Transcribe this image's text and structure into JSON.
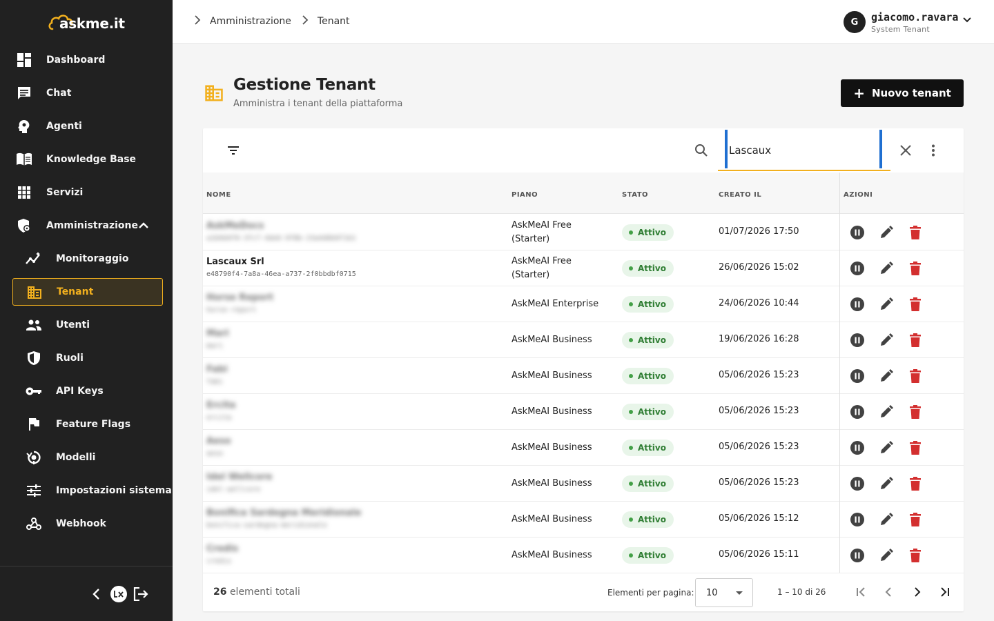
{
  "brand": {
    "logo_text": "askme.it",
    "accent": "#f2b01e"
  },
  "sidebar": {
    "items": [
      {
        "label": "Dashboard",
        "icon": "dashboard-icon"
      },
      {
        "label": "Chat",
        "icon": "chat-icon"
      },
      {
        "label": "Agenti",
        "icon": "agent-icon"
      },
      {
        "label": "Knowledge Base",
        "icon": "book-icon"
      },
      {
        "label": "Servizi",
        "icon": "grid-icon"
      },
      {
        "label": "Amministrazione",
        "icon": "admin-icon",
        "expanded": true
      }
    ],
    "subitems": [
      {
        "label": "Monitoraggio",
        "icon": "monitoring-icon"
      },
      {
        "label": "Tenant",
        "icon": "building-icon",
        "active": true
      },
      {
        "label": "Utenti",
        "icon": "users-icon"
      },
      {
        "label": "Ruoli",
        "icon": "shield-icon"
      },
      {
        "label": "API Keys",
        "icon": "key-icon"
      },
      {
        "label": "Feature Flags",
        "icon": "flag-icon"
      },
      {
        "label": "Modelli",
        "icon": "model-icon"
      },
      {
        "label": "Impostazioni sistema",
        "icon": "settings-sliders-icon"
      },
      {
        "label": "Webhook",
        "icon": "webhook-icon"
      }
    ]
  },
  "header": {
    "breadcrumb": [
      "Amministrazione",
      "Tenant"
    ],
    "user": {
      "initial": "G",
      "name": "giacomo.ravara",
      "role": "System Tenant"
    }
  },
  "page": {
    "title": "Gestione Tenant",
    "subtitle": "Amministra i tenant della piattaforma",
    "new_button": "Nuovo tenant"
  },
  "search": {
    "value": "Lascaux"
  },
  "table": {
    "columns": [
      "NOME",
      "PIANO",
      "STATO",
      "CREATO IL",
      "AZIONI"
    ],
    "rows": [
      {
        "name": "AskMeDocs",
        "id": "a1b9d4f0-3fc7-4de6-9f8b-23a4d6b9f1b1",
        "blurred": true,
        "plan": "AskMeAI Free\n(Starter)",
        "status": "Attivo",
        "created": "01/07/2026 17:50"
      },
      {
        "name": "Lascaux Srl",
        "id": "e48790f4-7a8a-46ea-a737-2f0bbdbf0715",
        "blurred": false,
        "plan": "AskMeAI Free\n(Starter)",
        "status": "Attivo",
        "created": "26/06/2026 15:02"
      },
      {
        "name": "Horse Report",
        "id": "horse-report",
        "blurred": true,
        "plan": "AskMeAI Enterprise",
        "status": "Attivo",
        "created": "24/06/2026 10:44"
      },
      {
        "name": "Mari",
        "id": "mari",
        "blurred": true,
        "plan": "AskMeAI Business",
        "status": "Attivo",
        "created": "19/06/2026 16:28"
      },
      {
        "name": "Fabi",
        "id": "fabi",
        "blurred": true,
        "plan": "AskMeAI Business",
        "status": "Attivo",
        "created": "05/06/2026 15:23"
      },
      {
        "name": "Ercita",
        "id": "ercita",
        "blurred": true,
        "plan": "AskMeAI Business",
        "status": "Attivo",
        "created": "05/06/2026 15:23"
      },
      {
        "name": "Aeso",
        "id": "aeso",
        "blurred": true,
        "plan": "AskMeAI Business",
        "status": "Attivo",
        "created": "05/06/2026 15:23"
      },
      {
        "name": "Idel Wellcore",
        "id": "idel-wellcore",
        "blurred": true,
        "plan": "AskMeAI Business",
        "status": "Attivo",
        "created": "05/06/2026 15:23"
      },
      {
        "name": "Bonifica Sardegna Meridionale",
        "id": "bonifica-sardegna-meridionale",
        "blurred": true,
        "plan": "AskMeAI Business",
        "status": "Attivo",
        "created": "05/06/2026 15:12"
      },
      {
        "name": "Credis",
        "id": "credis",
        "blurred": true,
        "plan": "AskMeAI Business",
        "status": "Attivo",
        "created": "05/06/2026 15:11"
      }
    ]
  },
  "footer": {
    "total_count": "26",
    "total_label": "elementi totali",
    "per_page_label": "Elementi per pagina:",
    "per_page_value": "10",
    "range": "1 – 10 di 26"
  },
  "colors": {
    "status_green": "#2e7d32",
    "delete_red": "#d32f2f",
    "pause_gray": "#424242"
  }
}
